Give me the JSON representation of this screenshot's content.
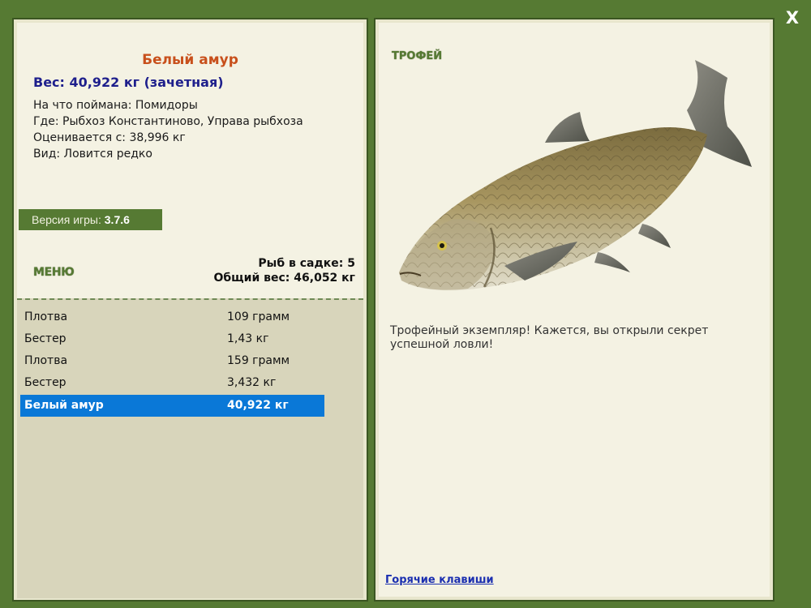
{
  "close_label": "X",
  "fish": {
    "title": "Белый амур",
    "weight_line": "Вес: 40,922 кг (зачетная)",
    "caught_on": "На что поймана: Помидоры",
    "location": "Где: Рыбхоз Константиново, Управа рыбхоза",
    "valued_from": "Оценивается с: 38,996 кг",
    "kind": "Вид: Ловится редко"
  },
  "version": {
    "label": "Версия игры:",
    "value": "3.7.6"
  },
  "menu_label": "МЕНЮ",
  "net": {
    "count_line": "Рыб в садке: 5",
    "total_line": "Общий вес: 46,052 кг"
  },
  "catch_list": [
    {
      "name": "Плотва",
      "weight": "109 грамм",
      "selected": false
    },
    {
      "name": "Бестер",
      "weight": "1,43 кг",
      "selected": false
    },
    {
      "name": "Плотва",
      "weight": "159 грамм",
      "selected": false
    },
    {
      "name": "Бестер",
      "weight": "3,432 кг",
      "selected": false
    },
    {
      "name": "Белый амур",
      "weight": "40,922 кг",
      "selected": true
    }
  ],
  "trophy": {
    "label": "ТРОФЕЙ",
    "message": "Трофейный экземпляр! Кажется, вы открыли секрет успешной ловли!"
  },
  "hotkeys_label": "Горячие клавиши",
  "colors": {
    "frame_green": "#567a33",
    "panel_bg": "#f4f2e3",
    "list_bg": "#d8d5bb",
    "selection_blue": "#0a78d7",
    "title_orange": "#c8501c",
    "weight_navy": "#1e1f8c"
  }
}
